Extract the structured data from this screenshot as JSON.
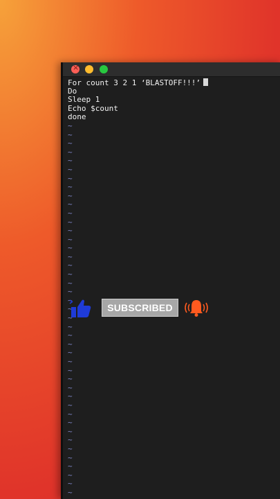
{
  "terminal": {
    "lines": [
      "For count 3 2 1 ‘BLASTOFF!!!’",
      "Do",
      "Sleep 1",
      "Echo $count",
      "done"
    ],
    "tilde": "~"
  },
  "overlay": {
    "subscribe_label": "SUBSCRIBED",
    "thumb_icon": "thumbs-up-icon",
    "bell_icon": "notification-bell-icon",
    "thumb_color": "#1f3bd8",
    "bell_color": "#ff5a1f"
  }
}
